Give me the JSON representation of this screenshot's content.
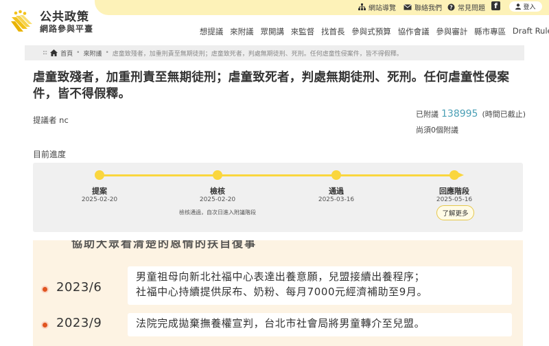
{
  "header": {
    "site_name": "公共政策",
    "site_sub": "網路參與平臺",
    "util": {
      "sitemap": "網站導覽",
      "contact": "聯絡我們",
      "faq": "常見問題",
      "facebook": "f",
      "login": "登入"
    },
    "nav": [
      "想提議",
      "來附議",
      "眾開講",
      "來監督",
      "找首長",
      "參與式預算",
      "協作會議",
      "參與審計",
      "縣市專區",
      "Draft Rules"
    ]
  },
  "breadcrumb": {
    "dots": ":::",
    "home": "首頁",
    "section": "來附議",
    "current": "虐童致殘者，加重刑責至無期徒刑；虐童致死者，判處無期徒刑、死刑。任何虐童性侵案件，皆不得假釋。"
  },
  "proposal": {
    "title": "虐童致殘者，加重刑責至無期徒刑；虐童致死者，判處無期徒刑、死刑。任何虐童性侵案件，皆不得假釋。",
    "proposer": "提議者 nc",
    "signed_prefix": "已附議",
    "signed_count": "138995",
    "signed_suffix": "(時間已截止)",
    "still_need": "尚須0個附議"
  },
  "progress": {
    "label": "目前進度",
    "stages": [
      {
        "name": "提案",
        "date": "2025-02-20"
      },
      {
        "name": "檢核",
        "date": "2025-02-20"
      },
      {
        "name": "通過",
        "date": "2025-03-16"
      },
      {
        "name": "回應階段",
        "date": "2025-05-16"
      }
    ],
    "note": "檢核通過，自次日進入附議階段",
    "more_button": "了解更多"
  },
  "embed": {
    "cut_text": "協助大眾看清楚的恩情的扶自復事",
    "items": [
      {
        "year": "2023/6",
        "lines": [
          "男童祖母向新北社福中心表達出養意願，兒盟接續出養程序；",
          "社福中心持續提供尿布、奶粉、每月7000元經濟補助至9月。"
        ]
      },
      {
        "year": "2023/9",
        "lines": [
          "法院完成拋棄撫養權宣判，台北市社會局將男童轉介至兒盟。"
        ]
      }
    ]
  },
  "colors": {
    "accent_yellow": "#fad63e",
    "topbar_yellow": "#fdf2b8",
    "count_blue": "#4a9fb5",
    "bullet_orange": "#e0541f"
  }
}
